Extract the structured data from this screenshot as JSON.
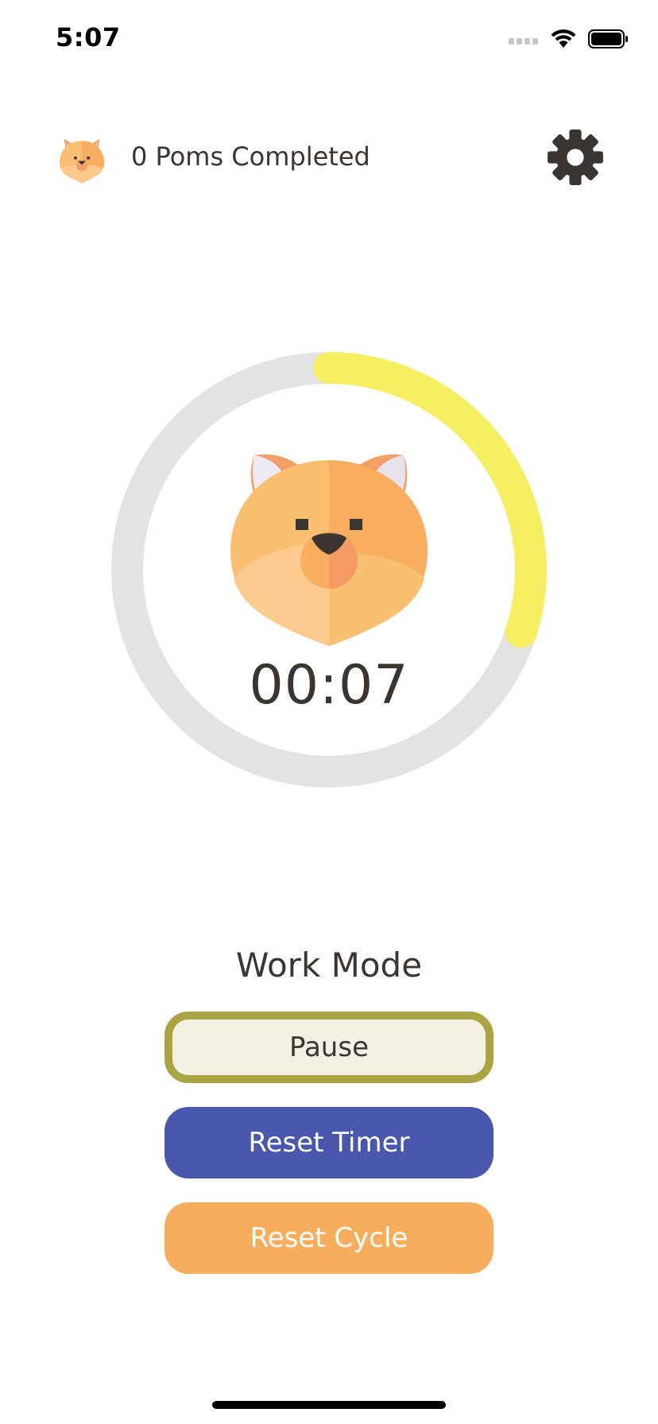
{
  "status_bar": {
    "time": "5:07",
    "icons": [
      "signal-icon",
      "wifi-icon",
      "battery-icon"
    ]
  },
  "header": {
    "avatar_icon": "shiba-avatar-icon",
    "poms_completed": "0 Poms Completed",
    "settings_icon": "gear-icon"
  },
  "timer": {
    "remaining": "00:07",
    "progress_fraction": 0.3,
    "mascot_icon": "shiba-face-icon"
  },
  "mode": {
    "label": "Work Mode"
  },
  "buttons": {
    "pause": "Pause",
    "reset_timer": "Reset Timer",
    "reset_cycle": "Reset Cycle"
  },
  "colors": {
    "ring_track": "#e3e3e6",
    "ring_progress": "#f6ef62",
    "pause_border": "#aaa443",
    "pause_bg": "#f3f1e4",
    "reset_timer_bg": "#4957ae",
    "reset_cycle_bg": "#f6ae5c",
    "text_dark": "#3a3530"
  }
}
